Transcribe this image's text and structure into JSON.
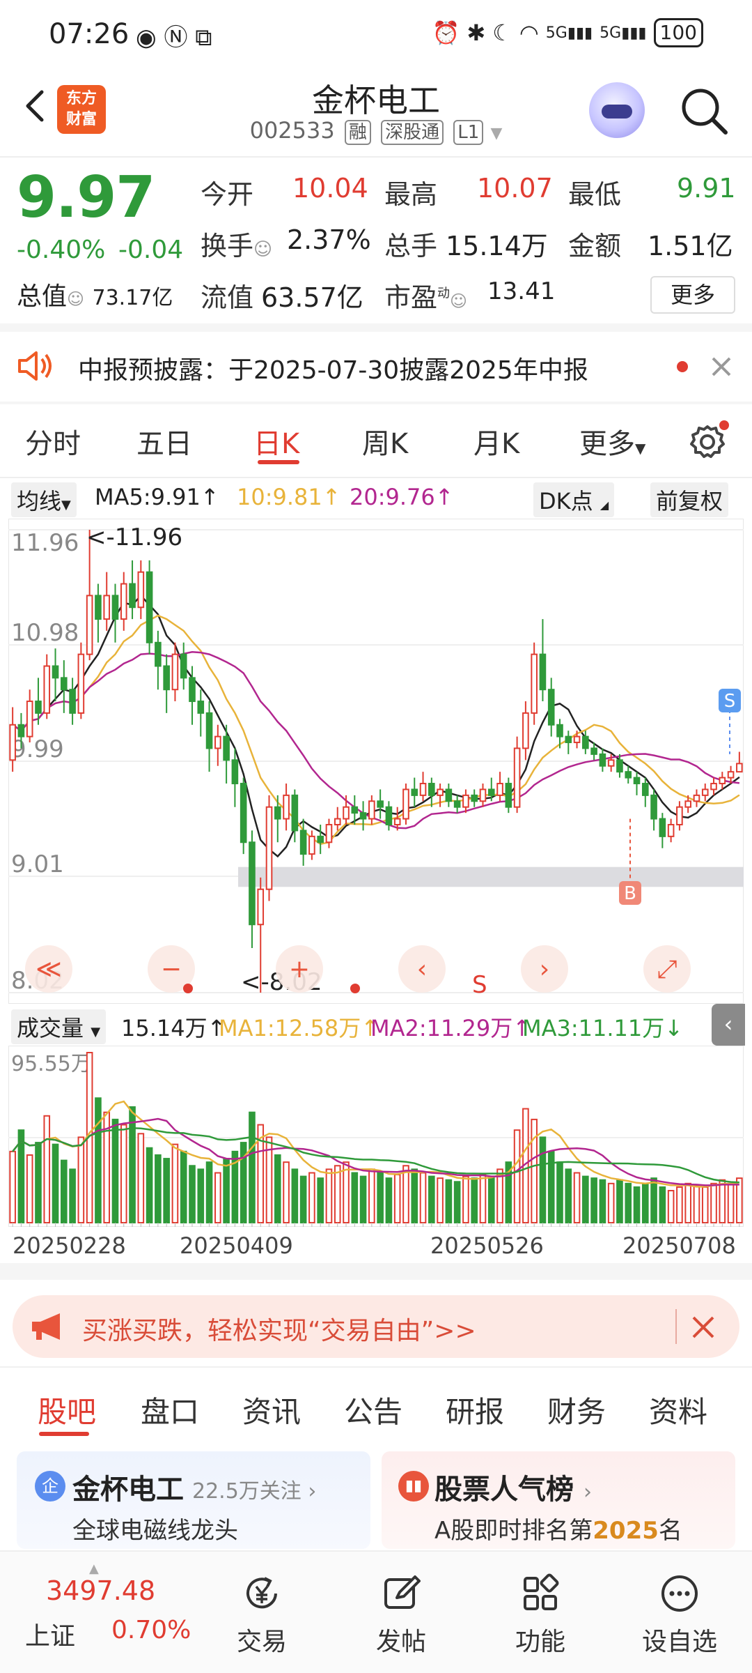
{
  "status_bar": {
    "time": "07:26",
    "battery": "100",
    "signal1": "5G",
    "signal2": "5G"
  },
  "header": {
    "title": "金杯电工",
    "code": "002533",
    "tags": [
      "融",
      "深股通",
      "L1"
    ],
    "logo_text_line1": "东方",
    "logo_text_line2": "财富"
  },
  "quote": {
    "price": "9.97",
    "change_pct": "-0.40%",
    "change_abs": "-0.04",
    "open_label": "今开",
    "open": "10.04",
    "high_label": "最高",
    "high": "10.07",
    "low_label": "最低",
    "low": "9.91",
    "turnover_label": "换手",
    "turnover": "2.37%",
    "volume_label": "总手",
    "volume": "15.14万",
    "amount_label": "金额",
    "amount": "1.51亿",
    "mktcap_label": "总值",
    "mktcap": "73.17亿",
    "float_label": "流值",
    "float": "63.57亿",
    "pe_label": "市盈",
    "pe_sup": "动",
    "pe": "13.41",
    "more_button": "更多"
  },
  "notice": {
    "text": "中报预披露：于2025-07-30披露2025年中报"
  },
  "kline_tabs": {
    "items": [
      "分时",
      "五日",
      "日K",
      "周K",
      "月K",
      "更多"
    ],
    "active": "日K"
  },
  "ma_row": {
    "selector": "均线",
    "ma5": "MA5:9.91↑",
    "ma10": "10:9.81↑",
    "ma20": "20:9.76↑",
    "dk": "DK点",
    "adjust": "前复权"
  },
  "chart_labels": {
    "y_ticks": [
      "11.96",
      "10.98",
      "9.99",
      "9.01",
      "8.02"
    ],
    "max_marker": "<-11.96",
    "min_marker": "<-8.02",
    "buy_marker": "B",
    "sell_marker": "S",
    "tool_s": "S"
  },
  "volume_row": {
    "selector": "成交量",
    "vol": "15.14万↑",
    "ma1": "MA1:12.58万↑",
    "ma2": "MA2:11.29万↑",
    "ma3": "MA3:11.11万↓",
    "y_max": "95.55万"
  },
  "dates": [
    "20250228",
    "20250409",
    "20250526",
    "20250708"
  ],
  "banner": {
    "text": "买涨买跌，轻松实现“交易自由”>>"
  },
  "bottom_tabs": {
    "items": [
      "股吧",
      "盘口",
      "资讯",
      "公告",
      "研报",
      "财务",
      "资料"
    ],
    "active": "股吧"
  },
  "card_left": {
    "badge": "企",
    "name": "金杯电工",
    "followers": "22.5万关注",
    "subtitle": "全球电磁线龙头"
  },
  "card_right": {
    "name": "股票人气榜",
    "subtitle_pre": "A股即时排名第",
    "rank": "2025",
    "subtitle_post": "名"
  },
  "bottom_nav": {
    "index_value": "3497.48",
    "index_name": "上证",
    "index_change": "0.70%",
    "items": [
      "交易",
      "发帖",
      "功能",
      "设自选"
    ]
  },
  "colors": {
    "up": "#e03c31",
    "down": "#2f9a3a",
    "ma5": "#222222",
    "ma10": "#e8b33a",
    "ma20": "#b2268f"
  },
  "chart_data": {
    "type": "candlestick",
    "ylim": [
      8.02,
      11.96
    ],
    "x_labels": [
      "20250228",
      "20250409",
      "20250526",
      "20250708"
    ],
    "candles": [
      [
        10.0,
        10.3,
        10.45,
        9.9
      ],
      [
        10.3,
        10.2,
        10.4,
        10.1
      ],
      [
        10.2,
        10.5,
        10.6,
        10.15
      ],
      [
        10.5,
        10.4,
        10.7,
        10.3
      ],
      [
        10.4,
        10.8,
        10.9,
        10.35
      ],
      [
        10.8,
        10.7,
        10.95,
        10.5
      ],
      [
        10.7,
        10.6,
        10.85,
        10.4
      ],
      [
        10.6,
        10.4,
        10.7,
        10.3
      ],
      [
        10.4,
        10.9,
        11.0,
        10.35
      ],
      [
        10.9,
        11.4,
        11.96,
        10.85
      ],
      [
        11.4,
        11.2,
        11.5,
        11.0
      ],
      [
        11.2,
        11.4,
        11.6,
        11.1
      ],
      [
        11.4,
        11.2,
        11.5,
        11.0
      ],
      [
        11.2,
        11.5,
        11.6,
        11.1
      ],
      [
        11.5,
        11.3,
        11.7,
        11.2
      ],
      [
        11.3,
        11.6,
        11.7,
        11.2
      ],
      [
        11.6,
        11.0,
        11.7,
        10.9
      ],
      [
        11.0,
        10.8,
        11.1,
        10.6
      ],
      [
        10.8,
        10.6,
        10.9,
        10.4
      ],
      [
        10.6,
        10.9,
        11.0,
        10.5
      ],
      [
        10.9,
        10.7,
        11.0,
        10.6
      ],
      [
        10.7,
        10.5,
        10.8,
        10.3
      ],
      [
        10.5,
        10.4,
        10.6,
        10.2
      ],
      [
        10.4,
        10.1,
        10.5,
        9.9
      ],
      [
        10.1,
        10.2,
        10.3,
        9.95
      ],
      [
        10.2,
        10.0,
        10.3,
        9.8
      ],
      [
        10.0,
        9.8,
        10.1,
        9.6
      ],
      [
        9.8,
        9.3,
        9.85,
        9.2
      ],
      [
        9.3,
        8.6,
        9.4,
        8.4
      ],
      [
        8.6,
        8.9,
        9.0,
        8.02
      ],
      [
        8.9,
        9.6,
        9.7,
        8.8
      ],
      [
        9.6,
        9.5,
        9.7,
        9.3
      ],
      [
        9.5,
        9.7,
        9.8,
        9.4
      ],
      [
        9.7,
        9.4,
        9.75,
        9.3
      ],
      [
        9.4,
        9.2,
        9.5,
        9.1
      ],
      [
        9.2,
        9.35,
        9.4,
        9.15
      ],
      [
        9.35,
        9.3,
        9.45,
        9.2
      ],
      [
        9.3,
        9.45,
        9.5,
        9.25
      ],
      [
        9.45,
        9.5,
        9.6,
        9.4
      ],
      [
        9.5,
        9.6,
        9.7,
        9.45
      ],
      [
        9.6,
        9.55,
        9.7,
        9.45
      ],
      [
        9.55,
        9.5,
        9.65,
        9.4
      ],
      [
        9.5,
        9.65,
        9.7,
        9.45
      ],
      [
        9.65,
        9.6,
        9.75,
        9.5
      ],
      [
        9.6,
        9.45,
        9.65,
        9.4
      ],
      [
        9.45,
        9.5,
        9.6,
        9.4
      ],
      [
        9.5,
        9.75,
        9.8,
        9.45
      ],
      [
        9.75,
        9.7,
        9.85,
        9.6
      ],
      [
        9.7,
        9.8,
        9.9,
        9.65
      ],
      [
        9.8,
        9.7,
        9.85,
        9.6
      ],
      [
        9.7,
        9.75,
        9.8,
        9.6
      ],
      [
        9.75,
        9.65,
        9.8,
        9.6
      ],
      [
        9.65,
        9.6,
        9.7,
        9.55
      ],
      [
        9.6,
        9.7,
        9.75,
        9.55
      ],
      [
        9.7,
        9.65,
        9.75,
        9.6
      ],
      [
        9.65,
        9.75,
        9.8,
        9.6
      ],
      [
        9.75,
        9.7,
        9.85,
        9.65
      ],
      [
        9.7,
        9.8,
        9.9,
        9.65
      ],
      [
        9.8,
        9.6,
        9.85,
        9.55
      ],
      [
        9.6,
        10.1,
        10.2,
        9.55
      ],
      [
        10.1,
        10.4,
        10.5,
        10.0
      ],
      [
        10.4,
        10.9,
        11.0,
        10.3
      ],
      [
        10.9,
        10.6,
        11.2,
        10.5
      ],
      [
        10.6,
        10.3,
        10.7,
        10.2
      ],
      [
        10.3,
        10.2,
        10.35,
        10.1
      ],
      [
        10.2,
        10.15,
        10.25,
        10.05
      ],
      [
        10.15,
        10.2,
        10.25,
        10.1
      ],
      [
        10.2,
        10.1,
        10.25,
        10.05
      ],
      [
        10.1,
        10.05,
        10.15,
        10.0
      ],
      [
        10.05,
        9.95,
        10.1,
        9.9
      ],
      [
        9.95,
        10.0,
        10.05,
        9.9
      ],
      [
        10.0,
        9.9,
        10.05,
        9.85
      ],
      [
        9.9,
        9.85,
        9.95,
        9.8
      ],
      [
        9.85,
        9.8,
        9.9,
        9.7
      ],
      [
        9.8,
        9.7,
        9.85,
        9.6
      ],
      [
        9.7,
        9.5,
        9.75,
        9.4
      ],
      [
        9.5,
        9.35,
        9.55,
        9.25
      ],
      [
        9.35,
        9.45,
        9.5,
        9.3
      ],
      [
        9.45,
        9.6,
        9.65,
        9.4
      ],
      [
        9.6,
        9.65,
        9.7,
        9.55
      ],
      [
        9.65,
        9.7,
        9.75,
        9.6
      ],
      [
        9.7,
        9.75,
        9.8,
        9.65
      ],
      [
        9.75,
        9.8,
        9.85,
        9.7
      ],
      [
        9.8,
        9.85,
        9.9,
        9.75
      ],
      [
        9.85,
        9.9,
        9.95,
        9.8
      ],
      [
        9.9,
        9.97,
        10.07,
        9.91
      ]
    ],
    "volume": [
      40,
      52,
      38,
      45,
      60,
      44,
      35,
      30,
      48,
      95.55,
      70,
      62,
      58,
      55,
      65,
      50,
      42,
      38,
      36,
      44,
      40,
      32,
      30,
      34,
      28,
      36,
      40,
      45,
      62,
      55,
      48,
      38,
      34,
      30,
      26,
      28,
      25,
      30,
      32,
      34,
      28,
      26,
      30,
      28,
      25,
      27,
      32,
      30,
      28,
      26,
      25,
      24,
      23,
      26,
      25,
      27,
      26,
      30,
      34,
      52,
      64,
      58,
      48,
      40,
      34,
      30,
      28,
      26,
      25,
      24,
      22,
      24,
      22,
      20,
      22,
      25,
      20,
      18,
      20,
      22,
      21,
      20,
      22,
      24,
      22,
      25
    ],
    "volume_ylim": [
      0,
      95.55
    ]
  }
}
